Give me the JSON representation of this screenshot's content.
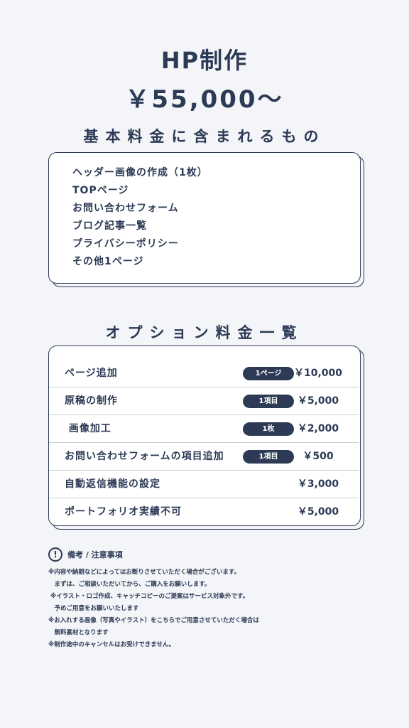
{
  "header": {
    "title": "HP制作",
    "price": "￥55,000〜"
  },
  "basic": {
    "heading": "基本料金に含まれるもの",
    "items": [
      "ヘッダー画像の作成（1枚）",
      "TOPページ",
      "お問い合わせフォーム",
      "ブログ記事一覧",
      "プライバシーポリシー",
      "その他1ページ"
    ]
  },
  "options": {
    "heading": "オプション料金一覧",
    "rows": [
      {
        "name": "ページ追加",
        "badge": "1ページ",
        "price": "￥10,000"
      },
      {
        "name": "原稿の制作",
        "badge": "1項目",
        "price": "￥5,000"
      },
      {
        "name": " 画像加工",
        "badge": "1枚",
        "price": "￥2,000"
      },
      {
        "name": "お問い合わせフォームの項目追加",
        "badge": "1項目",
        "price": "￥500"
      },
      {
        "name": "自動返信機能の設定",
        "badge": "",
        "price": "￥3,000"
      },
      {
        "name": "ポートフォリオ実績不可",
        "badge": "",
        "price": "￥5,000"
      }
    ]
  },
  "notes": {
    "icon": "exclamation-circle-icon",
    "title": "備考 / 注意事項",
    "lines": [
      "※内容や納期などによってはお断りさせていただく場合がございます。",
      "　まずは、ご相談いただいてから、ご購入をお願いします。",
      " ※イラスト・ロゴ作成、キャッチコピーのご提案はサービス対象外です。",
      "　予めご用意をお願いいたします",
      "※お入れする画像（写真やイラスト）をこちらでご用意させていただく場合は",
      "　無料素材となります",
      "※制作途中のキャンセルはお受けできません。"
    ]
  },
  "colors": {
    "background": "#f3f5f8",
    "navy": "#2c3a55",
    "card": "#ffffff"
  }
}
